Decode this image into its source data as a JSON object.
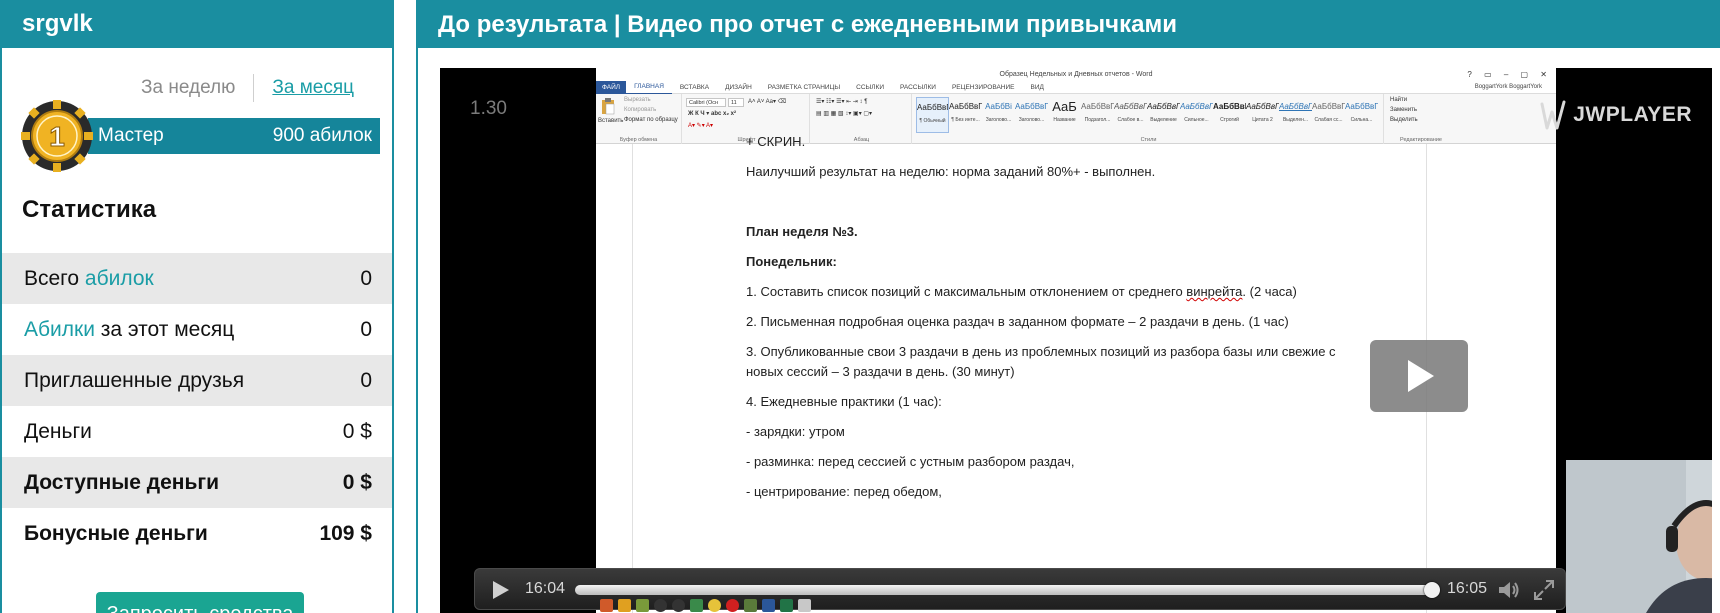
{
  "left": {
    "username": "srgvlk",
    "period_week": "За неделю",
    "period_month": "За месяц",
    "medal_number": "1",
    "rank_name": "Мастер",
    "rank_points": "900 абилок",
    "stats_title": "Статистика",
    "stats": [
      {
        "prefix": "Всего ",
        "accent": "абилок",
        "suffix": "",
        "value": "0"
      },
      {
        "prefix": "",
        "accent": "Абилки",
        "suffix": " за этот месяц",
        "value": "0"
      },
      {
        "prefix": "Приглашенные друзья",
        "accent": "",
        "suffix": "",
        "value": "0"
      },
      {
        "prefix": "Деньги",
        "accent": "",
        "suffix": "",
        "value": "0 $"
      },
      {
        "prefix": "Доступные деньги",
        "accent": "",
        "suffix": "",
        "value": "0 $"
      },
      {
        "prefix": "Бонусные деньги",
        "accent": "",
        "suffix": "",
        "value": "109 $"
      }
    ],
    "request_button": "Запросить средства"
  },
  "right": {
    "title": "До результата | Видео про отчет с ежедневными привычками"
  },
  "player": {
    "counter": "1.30",
    "logo": "JWPLAYER",
    "time_elapsed": "16:04",
    "time_total": "16:05",
    "progress": 0.999
  },
  "word": {
    "window_title": "Образец Недельных и Дневных отчетов - Word",
    "user": "BoggartYork BoggartYork",
    "tabs": [
      "ФАЙЛ",
      "ГЛАВНАЯ",
      "ВСТАВКА",
      "ДИЗАЙН",
      "РАЗМЕТКА СТРАНИЦЫ",
      "ССЫЛКИ",
      "РАССЫЛКИ",
      "РЕЦЕНЗИРОВАНИЕ",
      "ВИД"
    ],
    "ribbon": {
      "paste": "Вставить",
      "cut": "Вырезать",
      "copy": "Копировать",
      "format_painter": "Формат по образцу",
      "clipboard": "Буфер обмена",
      "font_name": "Calibri (Осн",
      "font_size": "11",
      "font_group": "Шрифт",
      "paragraph_group": "Абзац",
      "styles_group": "Стили",
      "editing_group": "Редактирование",
      "find": "Найти",
      "replace": "Заменить",
      "select": "Выделить",
      "styles": [
        {
          "sample": "АаБбВвГг,",
          "name": "¶ Обычный"
        },
        {
          "sample": "АаБбВвГг,",
          "name": "¶ Без инте..."
        },
        {
          "sample": "АаБбВі",
          "name": "Заголово..."
        },
        {
          "sample": "АаБбВвГ",
          "name": "Заголово..."
        },
        {
          "sample": "АаБ",
          "name": "Название"
        },
        {
          "sample": "АаБбВвГ",
          "name": "Подзагол..."
        },
        {
          "sample": "АаБбВвГг",
          "name": "Слабое в..."
        },
        {
          "sample": "АаБбВвГг",
          "name": "Выделение"
        },
        {
          "sample": "АаБбВвГг",
          "name": "Сильное..."
        },
        {
          "sample": "АаБбВвГг,",
          "name": "Строгий"
        },
        {
          "sample": "АаБбВвГг",
          "name": "Цитата 2"
        },
        {
          "sample": "АаБбВвГг",
          "name": "Выделен..."
        },
        {
          "sample": "АаБбВвГг",
          "name": "Слабая сс..."
        },
        {
          "sample": "АаБбВвГг",
          "name": "Сильна..."
        }
      ]
    },
    "doc": [
      {
        "text": "+ СКРИН.",
        "bold": false
      },
      {
        "text": "Наилучший результат на неделю: норма заданий 80%+ - выполнен.",
        "bold": false
      },
      {
        "text": "План неделя №3.",
        "bold": true
      },
      {
        "text": "Понедельник:",
        "bold": true
      },
      {
        "text": "1. Составить список позиций с максимальным отклонением от среднего ",
        "bold": false,
        "squiggle": "винрейта",
        "tail": ". (2 часа)"
      },
      {
        "text": "2. Письменная подробная оценка раздач в заданном формате – 2 раздачи в день. (1 час)",
        "bold": false
      },
      {
        "text": "3. Опубликованные свои 3 раздачи в день из проблемных позиций из разбора базы или свежие с",
        "bold": false
      },
      {
        "text": "новых сессий – 3 раздачи в день. (30 минут)",
        "bold": false
      },
      {
        "text": "4. Ежедневные практики (1 час):",
        "bold": false
      },
      {
        "text": "- зарядки: утром",
        "bold": false
      },
      {
        "text": "- разминка: перед сессией с устным разбором раздач,",
        "bold": false
      },
      {
        "text": "- центрирование: перед обедом,",
        "bold": false
      }
    ]
  },
  "colors": {
    "brand": "#1a8ea0",
    "accent_text": "#1a9da6",
    "button": "#1aa592"
  }
}
